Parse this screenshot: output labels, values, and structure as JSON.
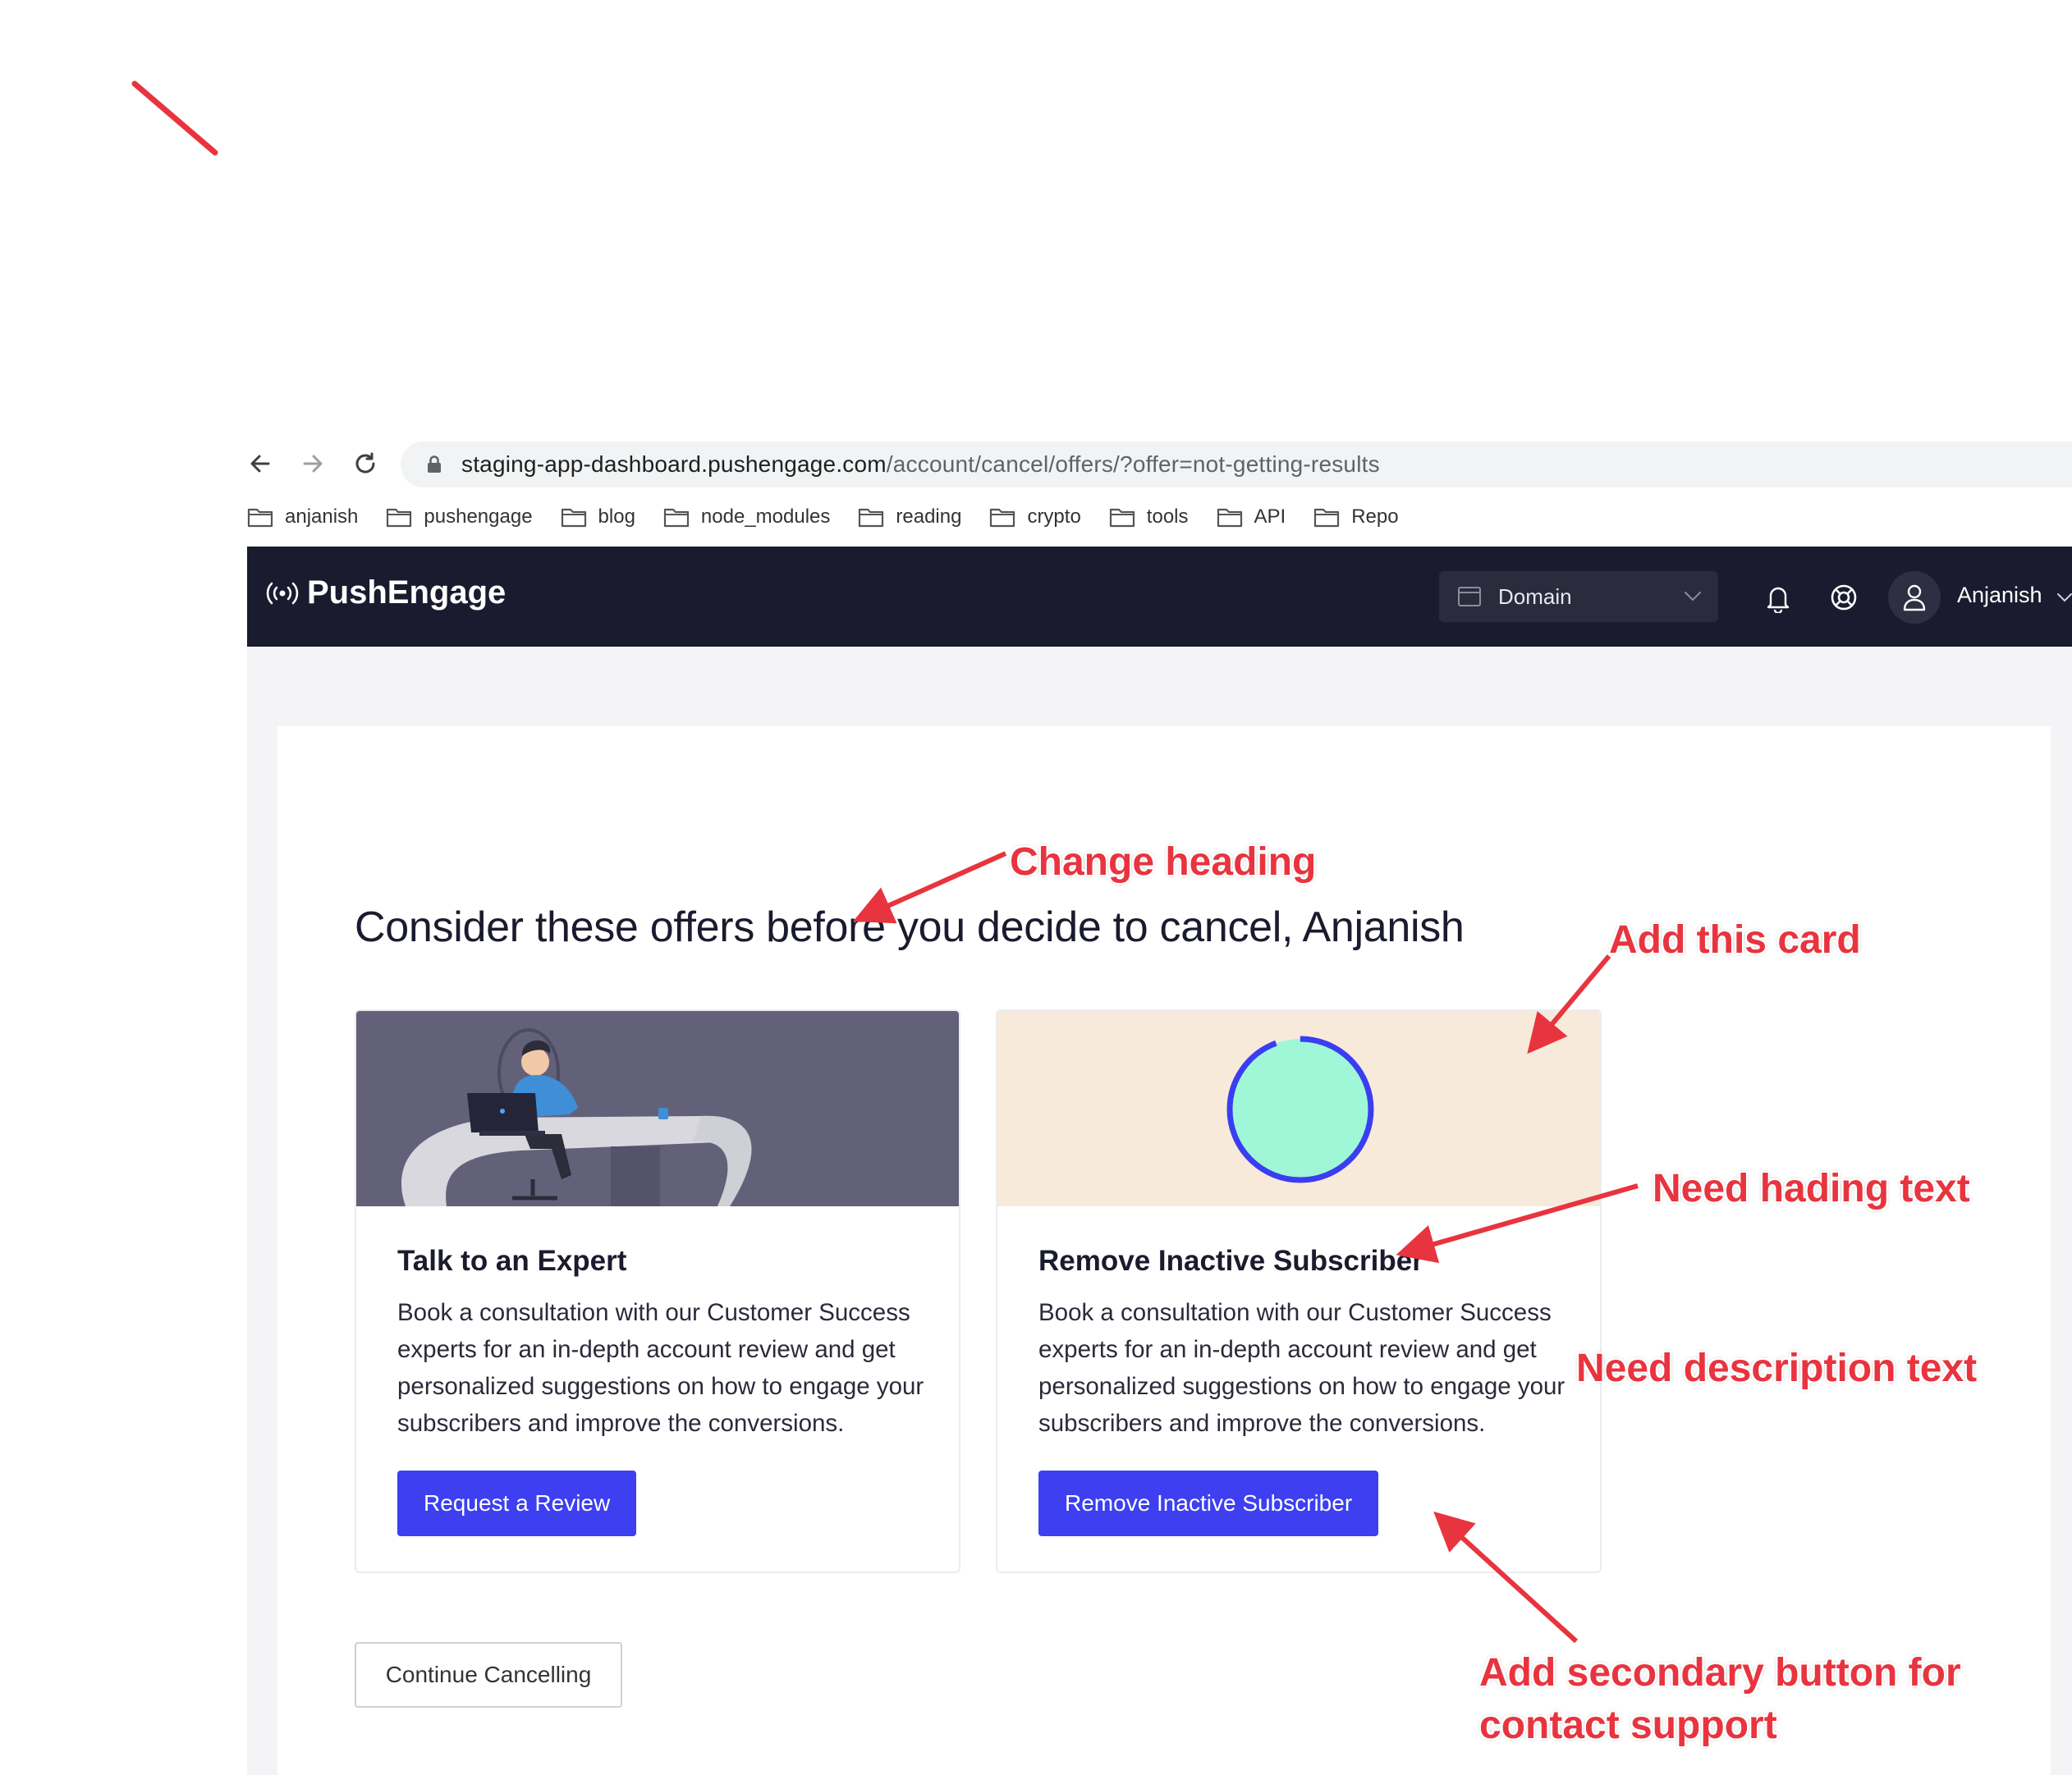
{
  "browser": {
    "url_host": "staging-app-dashboard.pushengage.com",
    "url_path": "/account/cancel/offers/?offer=not-getting-results",
    "bookmarks": [
      "anjanish",
      "pushengage",
      "blog",
      "node_modules",
      "reading",
      "crypto",
      "tools",
      "API",
      "Repo"
    ]
  },
  "app": {
    "logo_text": "PushEngage",
    "domain_label": "Domain",
    "user_name": "Anjanish"
  },
  "page": {
    "heading": "Consider these offers before you decide to cancel, Anjanish",
    "cards": [
      {
        "title": "Talk to an Expert",
        "description": "Book a consultation with our Customer Success experts for an in-depth account review and get personalized suggestions on how to engage your subscribers and improve the conversions.",
        "button": "Request a Review"
      },
      {
        "title": "Remove Inactive Subscriber",
        "description": "Book a consultation with our Customer Success experts for an in-depth account review and get personalized suggestions on how to engage your subscribers and improve the conversions.",
        "button": "Remove Inactive Subscriber"
      }
    ],
    "continue_button": "Continue Cancelling"
  },
  "annotations": {
    "change_heading": "Change heading",
    "add_card": "Add this card",
    "need_heading": "Need hading text",
    "need_description": "Need description text",
    "add_secondary_line1": "Add secondary button for",
    "add_secondary_line2": "contact support"
  },
  "colors": {
    "nav_bg": "#1b1b2f",
    "primary": "#3d3ff0",
    "annotation": "#e8343f",
    "card1_bg": "#636179",
    "card2_bg": "#f7eadb",
    "progress_fill": "#a0f7d7",
    "progress_ring": "#3a3ef0"
  }
}
